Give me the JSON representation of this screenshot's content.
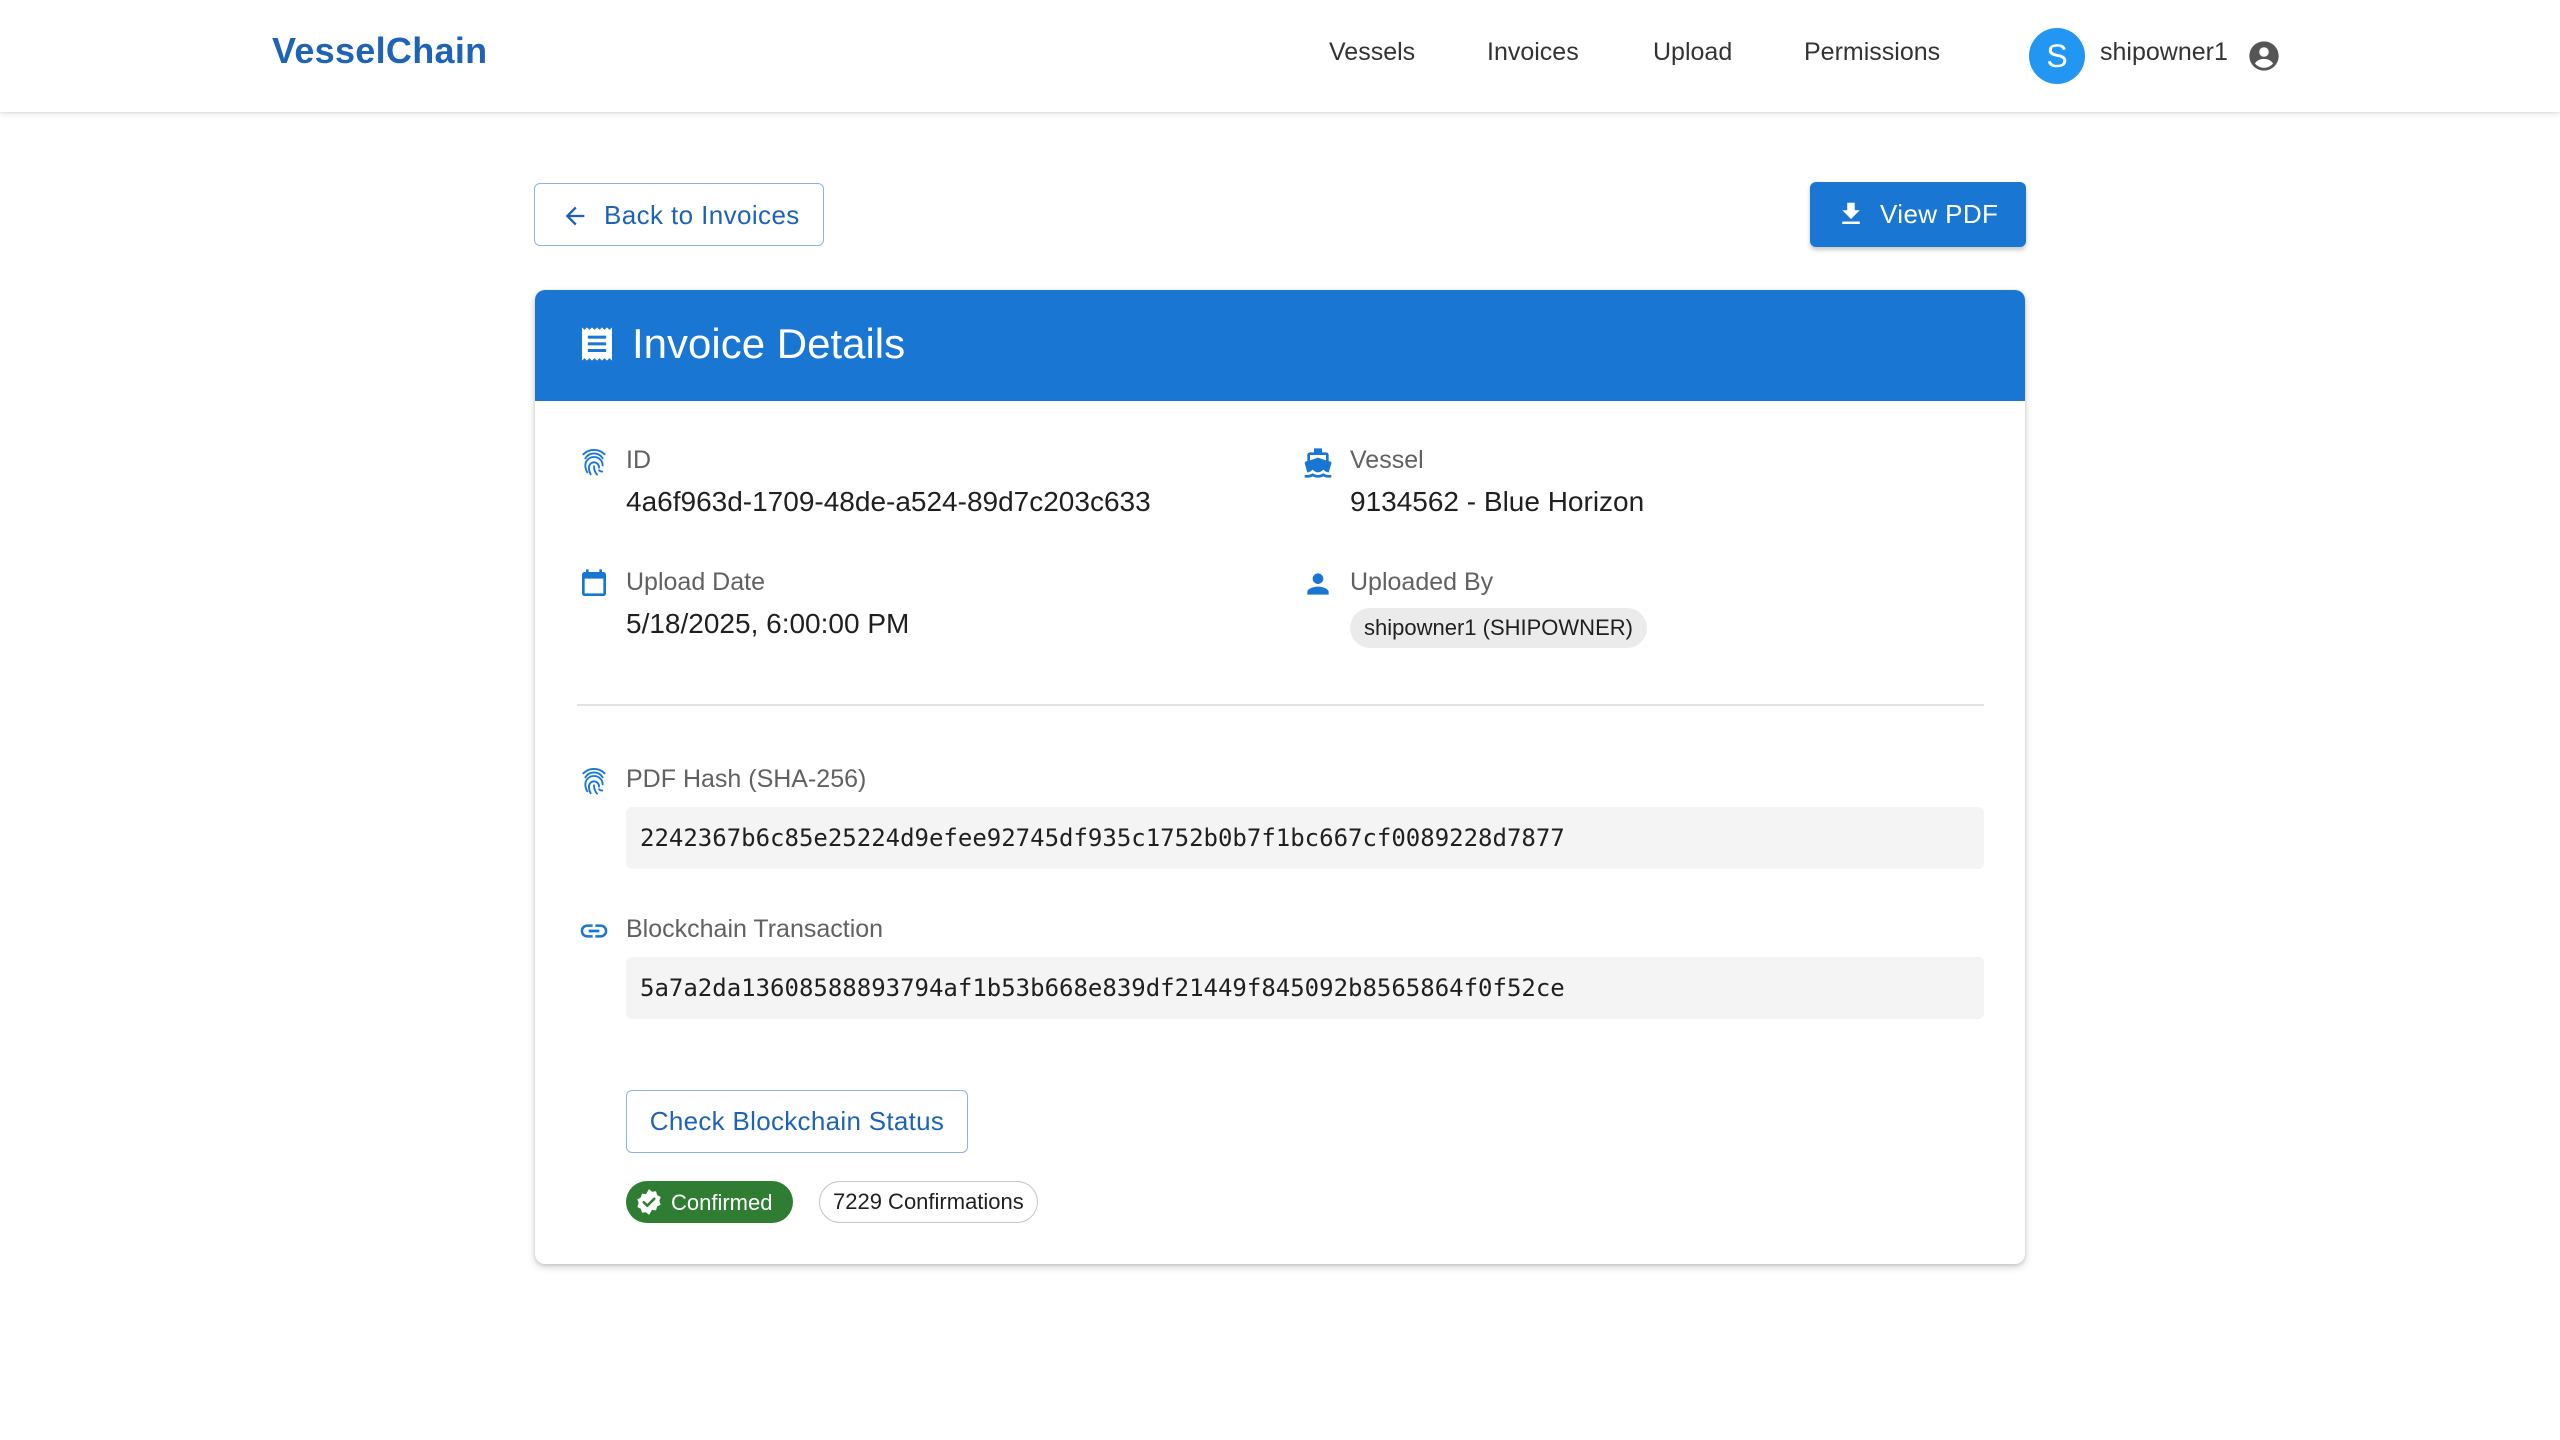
{
  "app": {
    "brand": "VesselChain",
    "nav": [
      "Vessels",
      "Invoices",
      "Upload",
      "Permissions"
    ],
    "user": {
      "initial": "S",
      "name": "shipowner1"
    }
  },
  "actions": {
    "back_label": "Back to Invoices",
    "view_pdf_label": "View PDF"
  },
  "invoice": {
    "title": "Invoice Details",
    "id_label": "ID",
    "id": "4a6f963d-1709-48de-a524-89d7c203c633",
    "vessel_label": "Vessel",
    "vessel": "9134562 - Blue Horizon",
    "upload_date_label": "Upload Date",
    "upload_date": "5/18/2025, 6:00:00 PM",
    "uploaded_by_label": "Uploaded By",
    "uploaded_by": "shipowner1 (SHIPOWNER)",
    "hash_label": "PDF Hash (SHA-256)",
    "hash": "2242367b6c85e25224d9efee92745df935c1752b0b7f1bc667cf0089228d7877",
    "tx_label": "Blockchain Transaction",
    "tx": "5a7a2da13608588893794af1b53b668e839df21449f845092b8565864f0f52ce",
    "check_status_label": "Check Blockchain Status",
    "status": "Confirmed",
    "confirmations": "7229 Confirmations"
  },
  "colors": {
    "primary": "#1976d2",
    "brand_text": "#1e63b5",
    "success": "#2e7d32",
    "avatar": "#2196f3"
  },
  "icons": {
    "id": "fingerprint-icon",
    "vessel": "ship-icon",
    "upload_date": "calendar-icon",
    "uploaded_by": "person-icon",
    "hash": "fingerprint-icon",
    "tx": "link-icon",
    "header": "receipt-icon",
    "status": "verified-check-icon"
  }
}
